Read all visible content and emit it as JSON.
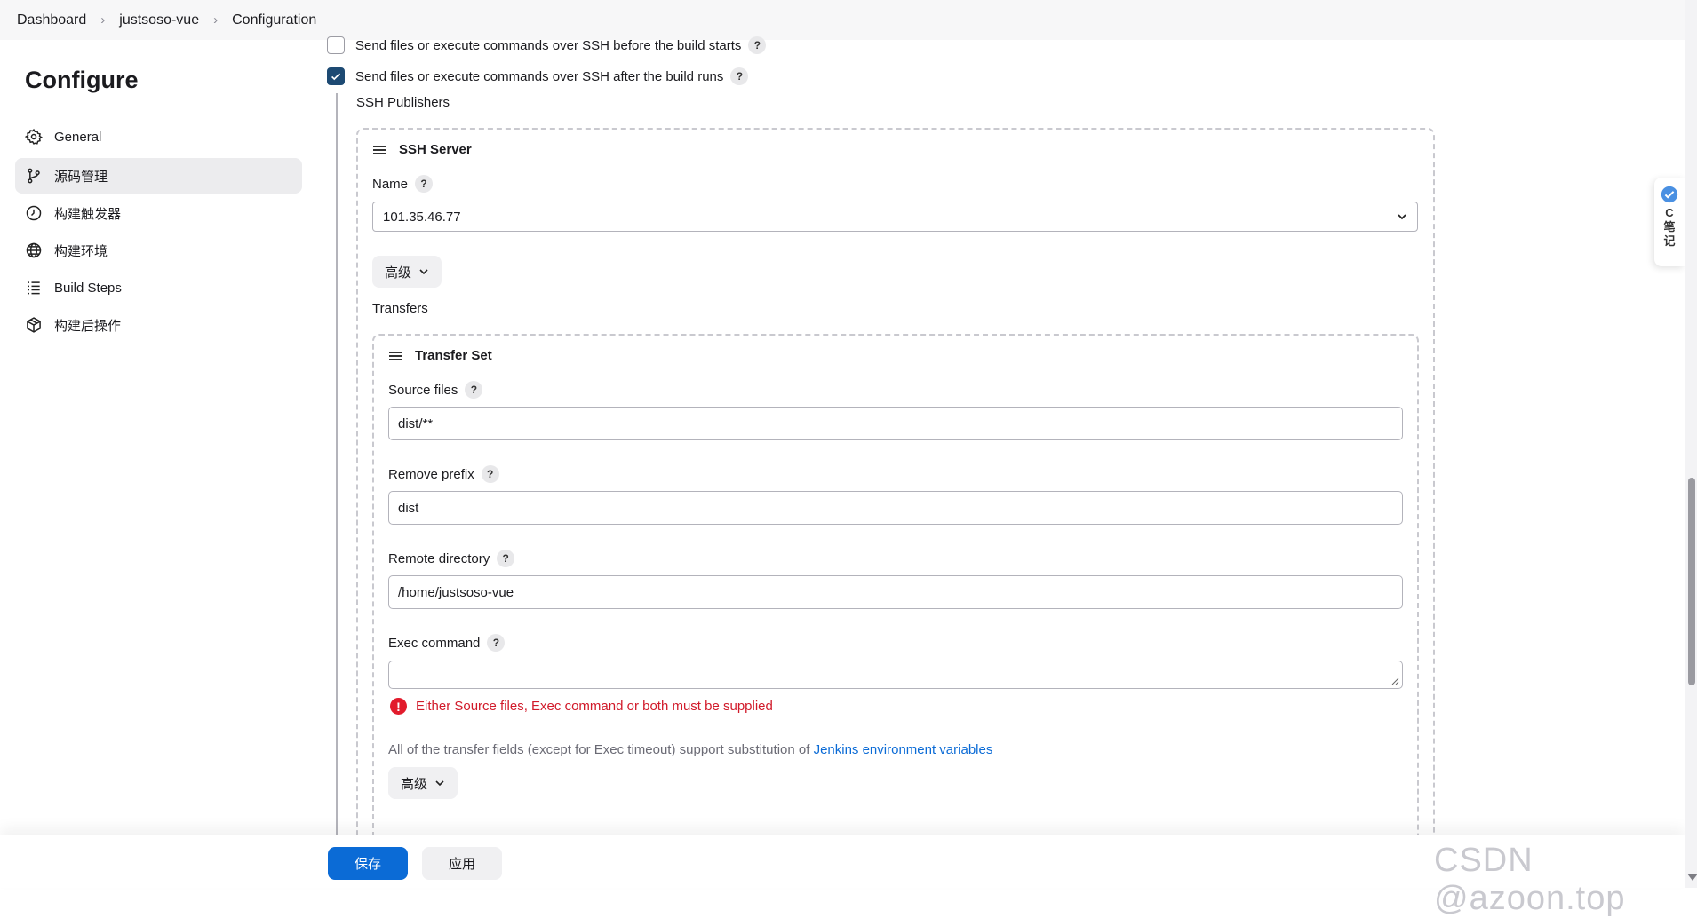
{
  "breadcrumb": [
    "Dashboard",
    "justsoso-vue",
    "Configuration"
  ],
  "sidebar": {
    "title": "Configure",
    "items": [
      {
        "label": "General",
        "icon": "gear-icon"
      },
      {
        "label": "源码管理",
        "icon": "branch-icon",
        "active": true
      },
      {
        "label": "构建触发器",
        "icon": "clock-icon"
      },
      {
        "label": "构建环境",
        "icon": "globe-icon"
      },
      {
        "label": "Build Steps",
        "icon": "list-icon"
      },
      {
        "label": "构建后操作",
        "icon": "box-icon"
      }
    ]
  },
  "options": {
    "before_build": {
      "label": "Send files or execute commands over SSH before the build starts",
      "checked": false
    },
    "after_build": {
      "label": "Send files or execute commands over SSH after the build runs",
      "checked": true
    }
  },
  "ssh_publishers_label": "SSH Publishers",
  "ssh_server": {
    "title": "SSH Server",
    "name_label": "Name",
    "name_value": "101.35.46.77",
    "advanced_label": "高级",
    "transfers_label": "Transfers"
  },
  "transfer_set": {
    "title": "Transfer Set",
    "source_files_label": "Source files",
    "source_files_value": "dist/**",
    "remove_prefix_label": "Remove prefix",
    "remove_prefix_value": "dist",
    "remote_directory_label": "Remote directory",
    "remote_directory_value": "/home/justsoso-vue",
    "exec_command_label": "Exec command",
    "exec_command_value": "",
    "error": "Either Source files, Exec command or both must be supplied",
    "note_text": "All of the transfer fields (except for Exec timeout) support substitution of ",
    "note_link": "Jenkins environment variables",
    "advanced_label": "高级"
  },
  "help_glyph": "?",
  "buttons": {
    "save": "保存",
    "apply": "应用"
  },
  "side_widget_text": "C笔记",
  "watermark": "CSDN @azoon.top",
  "colors": {
    "primary": "#0b6bd6",
    "checkbox_checked": "#1d4a73",
    "error": "#d11a2a",
    "link": "#0b6bd6"
  }
}
